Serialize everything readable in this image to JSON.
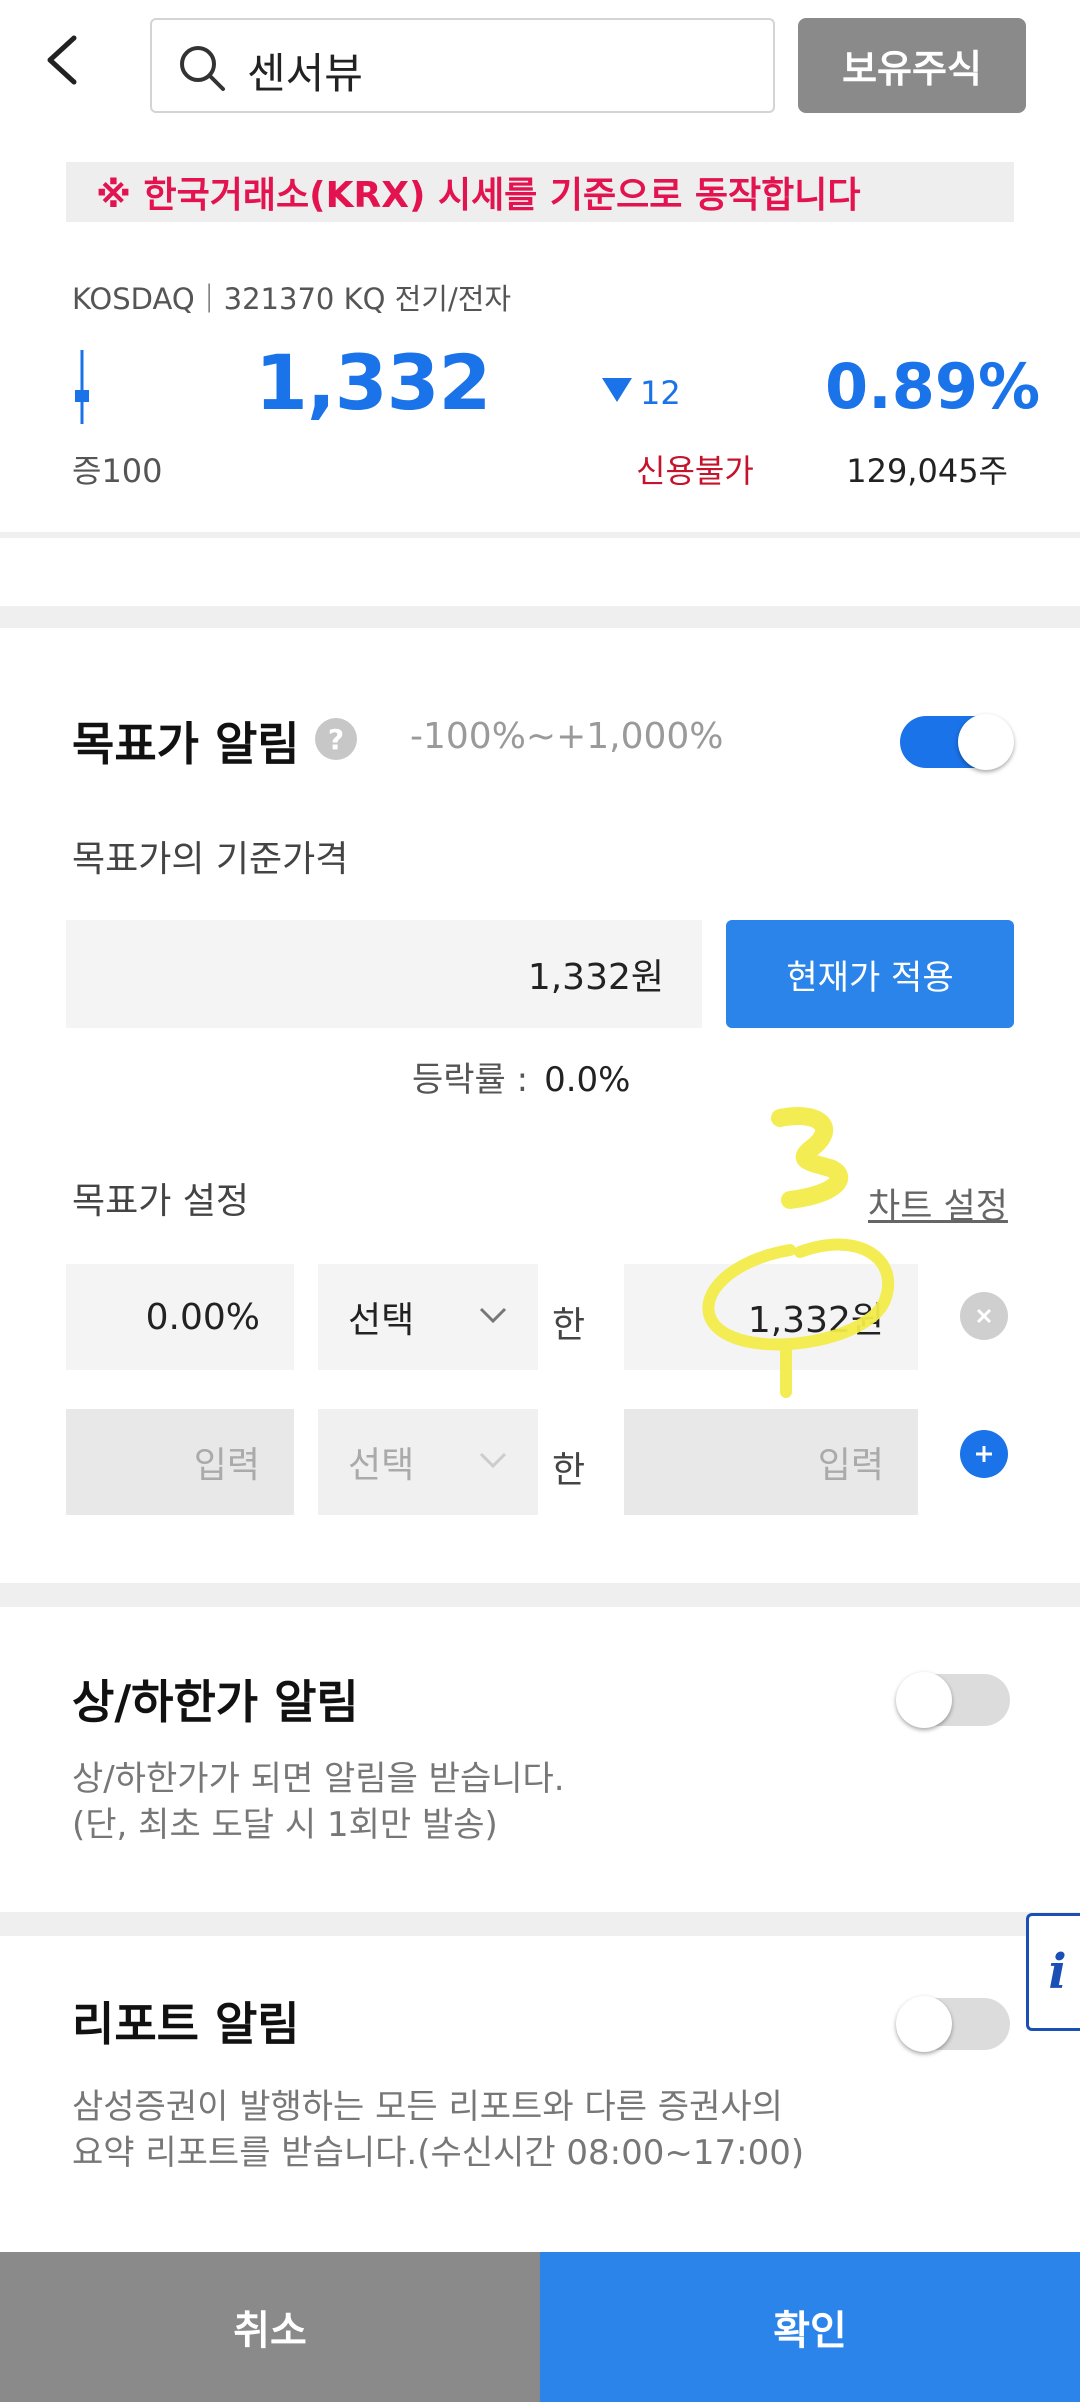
{
  "header": {
    "search_value": "센서뷰",
    "holding_button": "보유주식"
  },
  "notice": "※ 한국거래소(KRX) 시세를 기준으로 동작합니다",
  "stock": {
    "market_line": "KOSDAQ｜321370 KQ 전기/전자",
    "price": "1,332",
    "change_value": "12",
    "change_rate": "0.89%",
    "margin_rate": "증100",
    "credit": "신용불가",
    "volume": "129,045주"
  },
  "target_alert": {
    "title": "목표가 알림",
    "help": "?",
    "range": "-100%~+1,000%",
    "enabled": true,
    "base_label": "목표가의 기준가격",
    "base_value": "1,332원",
    "apply_button": "현재가 적용",
    "rate_label": "등락률 :",
    "rate_value": "0.0%",
    "setting_label": "목표가 설정",
    "chart_link": "차트 설정",
    "row1": {
      "percent": "0.00%",
      "select": "선택",
      "han": "한",
      "price": "1,332원"
    },
    "row2": {
      "percent": "입력",
      "select": "선택",
      "han": "한",
      "price": "입력"
    }
  },
  "limit_alert": {
    "title": "상/하한가 알림",
    "enabled": false,
    "desc1": "상/하한가가 되면 알림을 받습니다.",
    "desc2": "(단, 최초 도달 시 1회만 발송)"
  },
  "report_alert": {
    "title": "리포트 알림",
    "enabled": false,
    "desc1": "삼성증권이 발행하는 모든 리포트와 다른 증권사의",
    "desc2": "요약 리포트를 받습니다.(수신시간 08:00~17:00)"
  },
  "info_tab": "i",
  "footer": {
    "cancel": "취소",
    "confirm": "확인"
  },
  "colors": {
    "accent": "#1a73e8",
    "notice": "#e2134f",
    "credit": "#c4132a",
    "highlight": "#f2ec4a"
  }
}
